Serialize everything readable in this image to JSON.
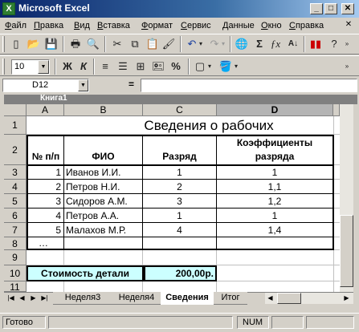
{
  "window": {
    "title": "Microsoft Excel",
    "workbook_title": "Книга1"
  },
  "menu": [
    "Файл",
    "Правка",
    "Вид",
    "Вставка",
    "Формат",
    "Сервис",
    "Данные",
    "Окно",
    "Справка"
  ],
  "toolbar": {
    "font_size": "10"
  },
  "formula_bar": {
    "name_box": "D12",
    "equals": "=",
    "formula": ""
  },
  "columns": [
    "A",
    "B",
    "C",
    "D"
  ],
  "rows": [
    "1",
    "2",
    "3",
    "4",
    "5",
    "6",
    "7",
    "8",
    "9",
    "10",
    "11"
  ],
  "sheet": {
    "title": "Сведения о рабочих",
    "headers": {
      "num": "№ п/п",
      "name": "ФИО",
      "grade": "Разряд",
      "coef_line1": "Коэффициенты",
      "coef_line2": "разряда"
    },
    "records": [
      {
        "num": "1",
        "name": "Иванов И.И.",
        "grade": "1",
        "coef": "1"
      },
      {
        "num": "2",
        "name": "Петров Н.И.",
        "grade": "2",
        "coef": "1,1"
      },
      {
        "num": "3",
        "name": "Сидоров А.М.",
        "grade": "3",
        "coef": "1,2"
      },
      {
        "num": "4",
        "name": "Петров А.А.",
        "grade": "1",
        "coef": "1"
      },
      {
        "num": "5",
        "name": "Малахов М.Р.",
        "grade": "4",
        "coef": "1,4"
      }
    ],
    "ellipsis": "…",
    "cost_label": "Стоимость детали",
    "cost_value": "200,00р."
  },
  "tabs": [
    "Неделя3",
    "Неделя4",
    "Сведения",
    "Итог"
  ],
  "active_tab": "Сведения",
  "status": {
    "ready": "Готово",
    "num": "NUM"
  },
  "colors": {
    "title_start": "#0a246a",
    "highlight": "#ccffff",
    "chrome": "#d4d0c8"
  }
}
